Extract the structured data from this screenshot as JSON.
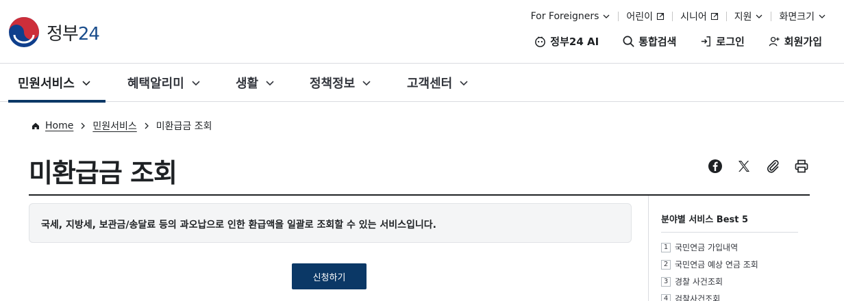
{
  "header": {
    "logo_text_a": "정부",
    "logo_text_b": "24",
    "util": [
      {
        "label": "For Foreigners"
      },
      {
        "label": "어린이"
      },
      {
        "label": "시니어"
      },
      {
        "label": "지원"
      },
      {
        "label": "화면크기"
      }
    ],
    "actions": {
      "ai": "정부24 AI",
      "search": "통합검색",
      "login": "로그인",
      "signup": "회원가입"
    }
  },
  "gnb": [
    {
      "label": "민원서비스"
    },
    {
      "label": "혜택알리미"
    },
    {
      "label": "생활"
    },
    {
      "label": "정책정보"
    },
    {
      "label": "고객센터"
    }
  ],
  "breadcrumb": {
    "home": "Home",
    "level1": "민원서비스",
    "current": "미환급금 조회"
  },
  "page": {
    "title": "미환급금 조회",
    "description": "국세, 지방세, 보관금/송달료 등의 과오납으로 인한 환급액을 일괄로 조회할 수 있는 서비스입니다.",
    "apply_button": "신청하기"
  },
  "best": {
    "title": "분야별 서비스 Best 5",
    "items": [
      {
        "num": "1",
        "label": "국민연금 가입내역"
      },
      {
        "num": "2",
        "label": "국민연금 예상 연금 조회"
      },
      {
        "num": "3",
        "label": "경찰 사건조회"
      },
      {
        "num": "4",
        "label": "검찰사건조회"
      }
    ]
  },
  "colors": {
    "brand_navy": "#0b3866",
    "logo_red": "#cd2e3a",
    "logo_blue": "#0f3f8c"
  }
}
